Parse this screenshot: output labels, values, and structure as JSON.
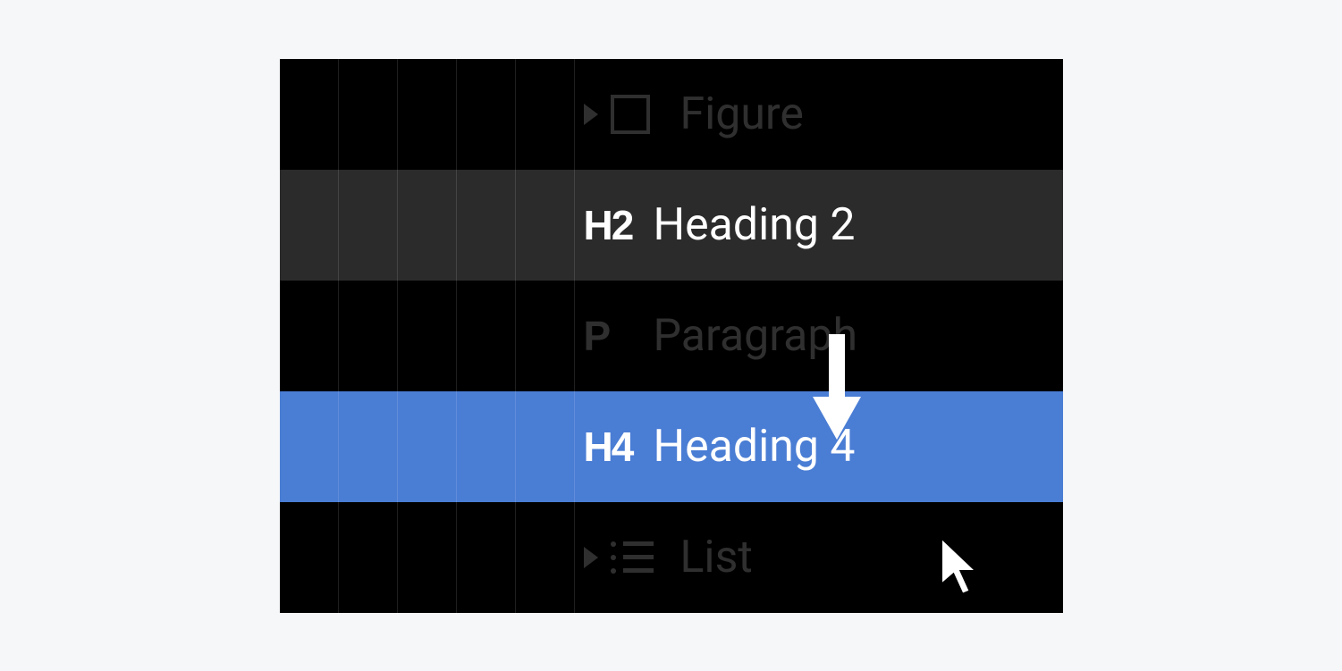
{
  "navigator": {
    "items": [
      {
        "icon_type": "square",
        "icon_text": "",
        "label": "Figure",
        "state": "dimmed",
        "expandable": true
      },
      {
        "icon_type": "text",
        "icon_text": "H2",
        "label": "Heading 2",
        "state": "hover",
        "expandable": false
      },
      {
        "icon_type": "text",
        "icon_text": "P",
        "label": "Paragraph",
        "state": "dimmed",
        "expandable": false
      },
      {
        "icon_type": "text",
        "icon_text": "H4",
        "label": "Heading 4",
        "state": "selected",
        "expandable": false
      },
      {
        "icon_type": "list",
        "icon_text": "",
        "label": "List",
        "state": "dimmed",
        "expandable": true
      }
    ]
  },
  "colors": {
    "selected": "#4a7dd4",
    "hover": "#2b2b2b",
    "background": "#000000",
    "page_background": "#f5f7f9"
  }
}
